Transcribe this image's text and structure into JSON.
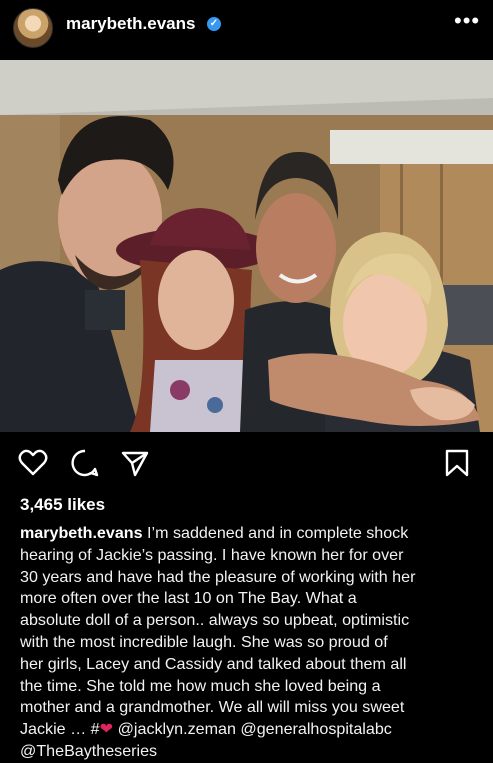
{
  "post": {
    "username": "marybeth.evans",
    "verified_icon": "verified-badge-icon",
    "more_icon": "more-options-icon",
    "likes": "3,465 likes",
    "caption_lines": [
      "I’m saddened and in complete shock",
      "hearing of Jackie’s passing. I have known her for over",
      "30 years and have had the pleasure of working with her",
      "more often over the last 10 on The Bay. What a",
      "absolute doll of a person.. always so upbeat, optimistic",
      "with the most incredible laugh. She was so proud of",
      "her girls, Lacey and Cassidy and talked about them all",
      "the time. She told me how much she loved being a",
      "mother and a grandmother.  We all will miss you sweet"
    ],
    "caption_last_prefix": "Jackie … #",
    "caption_mention_1": "@jacklyn.zeman",
    "caption_mention_2": "@generalhospitalabc",
    "caption_mention_3": "@TheBaytheseries"
  },
  "colors": {
    "background": "#000000",
    "text": "#f5f5f5",
    "verified": "#3897f0",
    "heart": "#e0245e"
  }
}
